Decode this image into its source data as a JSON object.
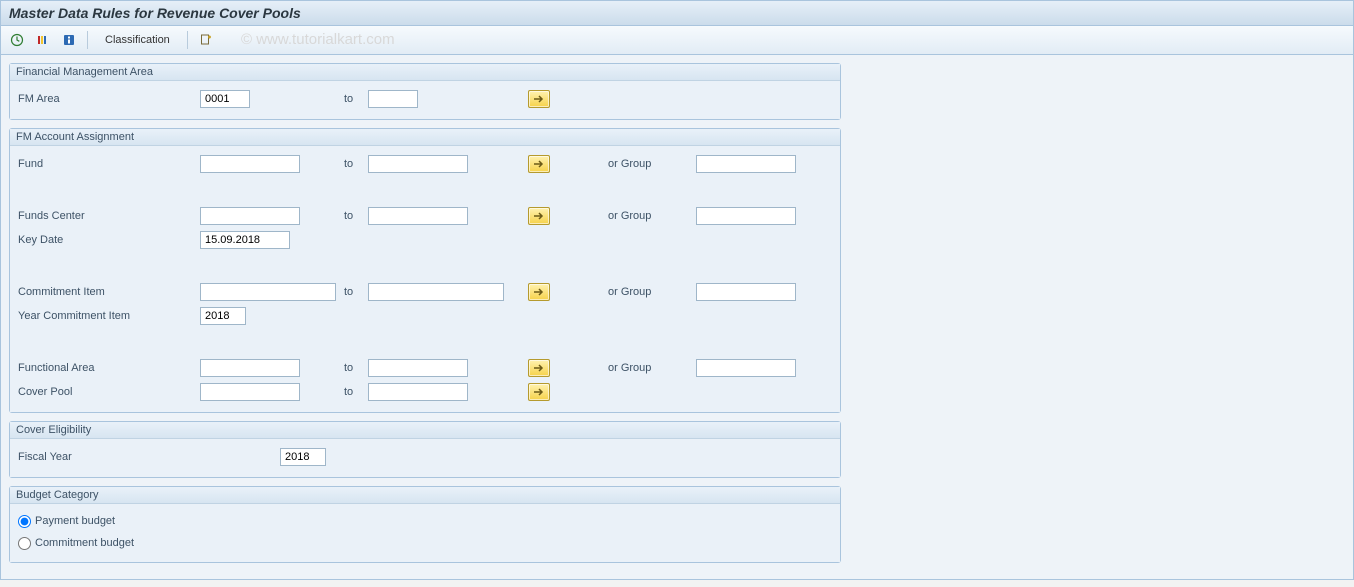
{
  "header": {
    "title": "Master Data Rules for Revenue Cover Pools"
  },
  "watermark": "© www.tutorialkart.com",
  "toolbar": {
    "classification": "Classification"
  },
  "groups": {
    "fma": {
      "title": "Financial Management Area",
      "fmarea_label": "FM Area",
      "fmarea_from": "0001",
      "fmarea_to": "",
      "to_label": "to"
    },
    "assign": {
      "title": "FM Account Assignment",
      "to_label": "to",
      "group_label": "or Group",
      "fund_label": "Fund",
      "fund_from": "",
      "fund_to": "",
      "fund_group": "",
      "fc_label": "Funds Center",
      "fc_from": "",
      "fc_to": "",
      "fc_group": "",
      "keydate_label": "Key Date",
      "keydate": "15.09.2018",
      "ci_label": "Commitment Item",
      "ci_from": "",
      "ci_to": "",
      "ci_group": "",
      "yci_label": "Year Commitment Item",
      "yci": "2018",
      "fa_label": "Functional Area",
      "fa_from": "",
      "fa_to": "",
      "fa_group": "",
      "cp_label": "Cover Pool",
      "cp_from": "",
      "cp_to": ""
    },
    "cover": {
      "title": "Cover Eligibility",
      "fy_label": "Fiscal Year",
      "fy": "2018"
    },
    "budget": {
      "title": "Budget Category",
      "pb_label": "Payment budget",
      "cb_label": "Commitment budget"
    }
  }
}
